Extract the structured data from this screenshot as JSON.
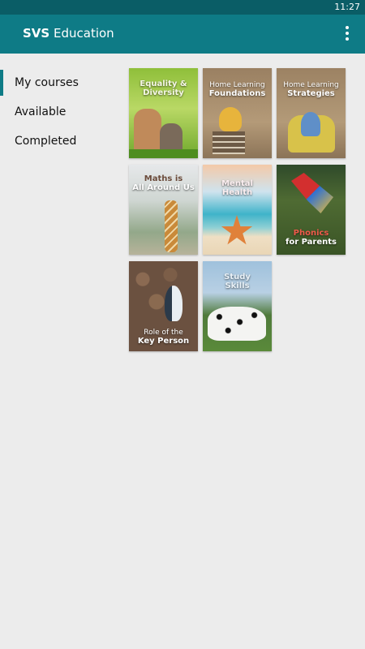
{
  "status": {
    "time": "11:27"
  },
  "header": {
    "brand": "SVS",
    "title": "Education",
    "menu_icon": "more-vert-icon"
  },
  "sidebar": {
    "items": [
      {
        "label": "My courses",
        "active": true
      },
      {
        "label": "Available",
        "active": false
      },
      {
        "label": "Completed",
        "active": false
      }
    ]
  },
  "courses": [
    {
      "line1": "Equality &",
      "line2": "Diversity"
    },
    {
      "line1": "Home Learning",
      "line2": "Foundations"
    },
    {
      "line1": "Home Learning",
      "line2": "Strategies"
    },
    {
      "line1": "Maths is",
      "line2": "All Around Us"
    },
    {
      "line1": "Mental",
      "line2": "Health"
    },
    {
      "line1": "Phonics",
      "line2": "for Parents"
    },
    {
      "line1": "Role of the",
      "line2": "Key Person"
    },
    {
      "line1": "Study",
      "line2": "Skills"
    }
  ],
  "colors": {
    "app_bar": "#0e7b86",
    "status_bar": "#0a5d66",
    "background": "#ececec"
  }
}
